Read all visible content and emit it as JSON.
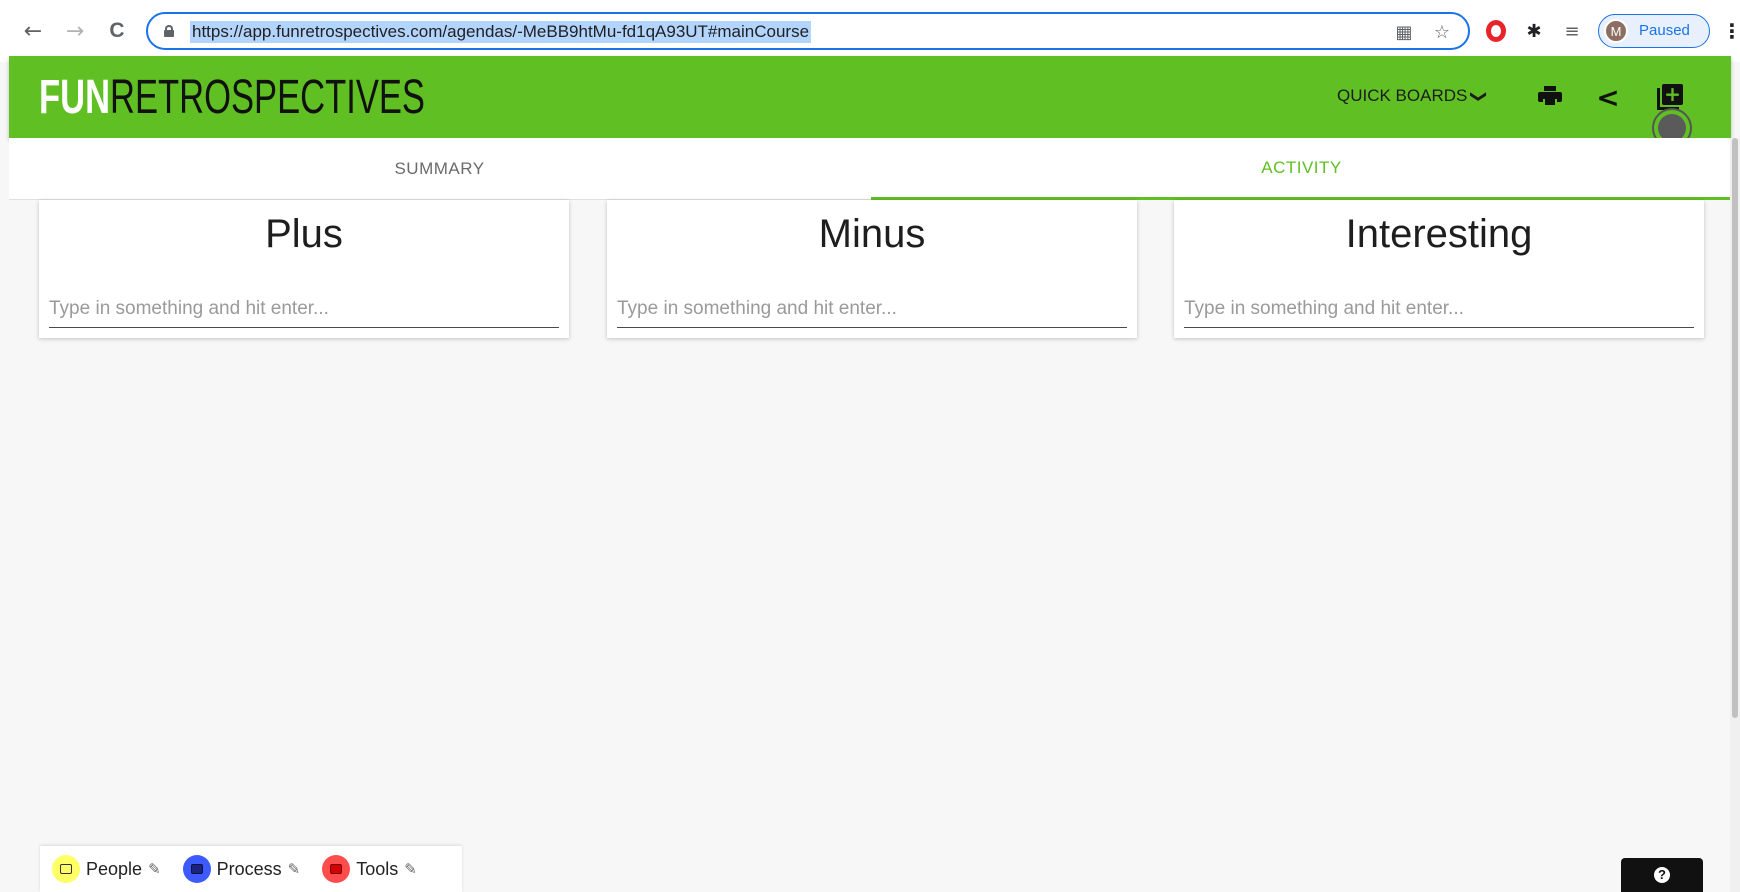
{
  "browser": {
    "url": "https://app.funretrospectives.com/agendas/-MeBB9htMu-fd1qA93UT#mainCourse",
    "back_icon": "←",
    "forward_icon": "→",
    "reload_icon": "C",
    "qr_icon": "▦",
    "star_icon": "☆",
    "extensions_icon": "✱",
    "reading_list_icon": "≡",
    "profile_initial": "M",
    "profile_status": "Paused",
    "menu_icon": "⋮"
  },
  "header": {
    "logo_part1": "FUN",
    "logo_part2": "RETROSPECTIVES",
    "quick_boards_label": "QUICK BOARDS",
    "quick_boards_chevron": "❯",
    "share_icon": "<",
    "add_icon": "+",
    "brand_color": "#60c023"
  },
  "tabs": [
    {
      "label": "SUMMARY",
      "active": false
    },
    {
      "label": "ACTIVITY",
      "active": true
    }
  ],
  "columns": [
    {
      "title": "Plus",
      "placeholder": "Type in something and hit enter..."
    },
    {
      "title": "Minus",
      "placeholder": "Type in something and hit enter..."
    },
    {
      "title": "Interesting",
      "placeholder": "Type in something and hit enter..."
    }
  ],
  "legend": [
    {
      "label": "People",
      "color": "#ffff66",
      "square_color": "#ffff66"
    },
    {
      "label": "Process",
      "color": "#3d5afe",
      "square_color": "#1a237e"
    },
    {
      "label": "Tools",
      "color": "#ff4d4d",
      "square_color": "#d50000"
    }
  ],
  "legend_pencil_icon": "✎",
  "help_icon": "?"
}
